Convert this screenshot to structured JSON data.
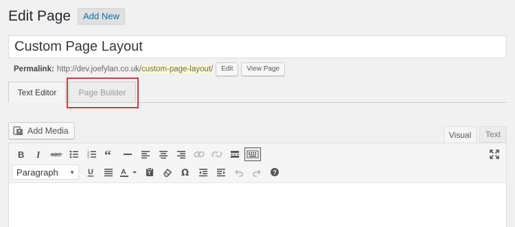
{
  "header": {
    "title": "Edit Page",
    "add_new": "Add New"
  },
  "post": {
    "title_value": "Custom Page Layout"
  },
  "permalink": {
    "label": "Permalink:",
    "base_url": "http://dev.joefylan.co.uk/",
    "slug": "custom-page-layout",
    "trailing": "/",
    "edit_button": "Edit",
    "view_button": "View Page"
  },
  "builder_tabs": [
    {
      "label": "Text Editor",
      "active": true
    },
    {
      "label": "Page Builder",
      "active": false,
      "highlighted": true
    }
  ],
  "add_media": {
    "label": "Add Media",
    "icon": "media-icon"
  },
  "editor_modes": [
    {
      "label": "Visual",
      "active": true
    },
    {
      "label": "Text",
      "active": false
    }
  ],
  "toolbar": {
    "row1": [
      "bold-icon",
      "italic-icon",
      "strikethrough-icon",
      "bullet-list-icon",
      "numbered-list-icon",
      "blockquote-icon",
      "horizontal-line-icon",
      "align-left-icon",
      "align-center-icon",
      "align-right-icon",
      "insert-link-icon",
      "remove-link-icon",
      "read-more-icon",
      "toolbar-toggle-icon"
    ],
    "row2": [
      "underline-icon",
      "justify-icon",
      "text-color-icon",
      "paste-text-icon",
      "clear-formatting-icon",
      "special-character-icon",
      "outdent-icon",
      "indent-icon",
      "undo-icon",
      "redo-icon",
      "help-icon"
    ],
    "format_select": "Paragraph",
    "fullscreen_icon": "fullscreen-icon"
  },
  "colors": {
    "link": "#0073aa",
    "highlight_border": "#d9333f",
    "slug_bg": "#fffbcc"
  }
}
